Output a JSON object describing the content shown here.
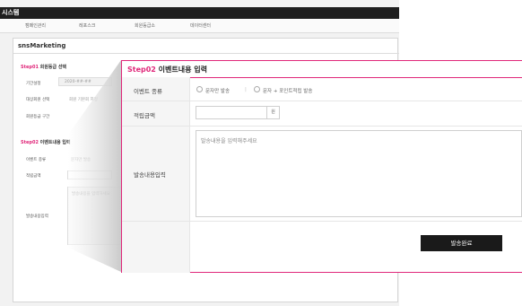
{
  "app": {
    "title_fragment": "시스템",
    "nav": [
      "캠페인관리",
      "레포스크",
      "회원등급소",
      "데이터센터"
    ],
    "page_title": "snsMarketing"
  },
  "background": {
    "step1": {
      "step": "Step01",
      "title": "회원등급 선택"
    },
    "step1_rows": [
      {
        "label": "기간설정",
        "value": "2020-##-##"
      },
      {
        "label": "대상회원 선택",
        "value": "회원 기본회 지정"
      },
      {
        "label": "회원등급 구간",
        "value": ""
      }
    ],
    "step2": {
      "step": "Step02",
      "title": "이벤트내용 입력"
    },
    "step2_rows": [
      {
        "label": "이벤트 종류",
        "value": "문자만 발송"
      },
      {
        "label": "적립금액",
        "value": ""
      },
      {
        "label": "발송내용입력",
        "value": "발송내용을 입력하세요"
      }
    ]
  },
  "panel": {
    "step": "Step02",
    "title": "이벤트내용 입력",
    "event_type_label": "이벤트 종류",
    "options": [
      "문자만 발송",
      "문자 + 포인트적립 발송"
    ],
    "separator": "|",
    "amount_label": "적립금액",
    "amount_value": "",
    "amount_unit": "원",
    "message_label": "발송내용입력",
    "message_placeholder": "발송내용을 입력해주세요",
    "send_label": "발송완료"
  },
  "colors": {
    "accent": "#e0287a",
    "titlebar": "#1e1e1e",
    "button": "#1a1a1a"
  }
}
